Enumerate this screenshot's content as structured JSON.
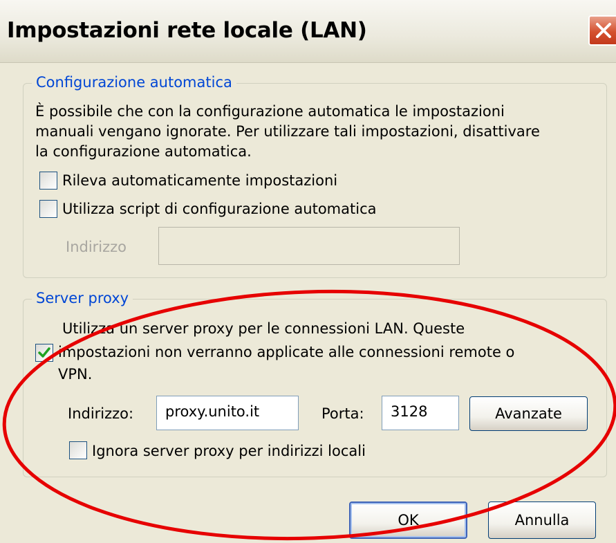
{
  "window": {
    "title": "Impostazioni rete locale (LAN)"
  },
  "auto_config": {
    "legend": "Configurazione automatica",
    "description_lines": [
      "È possibile che con la configurazione automatica le impostazioni",
      "manuali vengano ignorate. Per utilizzare tali impostazioni, disattivare",
      "la configurazione automatica."
    ],
    "detect_label": "Rileva automaticamente impostazioni",
    "detect_checked": false,
    "script_label": "Utilizza script di configurazione automatica",
    "script_checked": false,
    "address_label": "Indirizzo",
    "address_value": ""
  },
  "proxy": {
    "legend": "Server proxy",
    "use_proxy_lines": [
      "Utilizza un server proxy per le connessioni LAN. Queste",
      "impostazioni non verranno applicate alle connessioni remote o",
      "VPN."
    ],
    "use_proxy_checked": true,
    "address_label": "Indirizzo:",
    "address_value": "proxy.unito.it",
    "port_label": "Porta:",
    "port_value": "3128",
    "advanced_label": "Avanzate",
    "bypass_label": "Ignora server proxy per indirizzi locali",
    "bypass_checked": false
  },
  "buttons": {
    "ok": "OK",
    "cancel": "Annulla"
  },
  "colors": {
    "group_legend": "#0046d5",
    "annotation_ellipse": "#e60000",
    "check_mark": "#21a121"
  },
  "icons": {
    "close": "close-icon",
    "check": "check-icon"
  }
}
